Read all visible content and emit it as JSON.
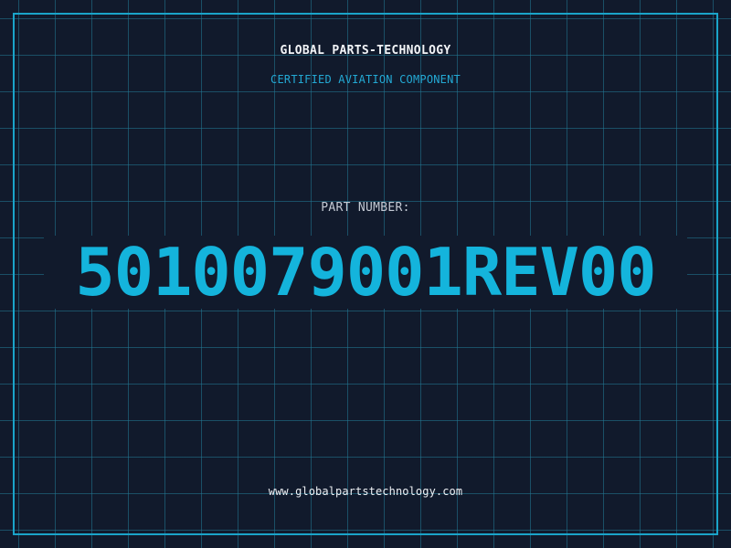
{
  "header": {
    "company": "GLOBAL PARTS-TECHNOLOGY",
    "tagline": "CERTIFIED AVIATION COMPONENT"
  },
  "part": {
    "label": "PART NUMBER:",
    "number": "5010079001REV00"
  },
  "footer": {
    "website": "www.globalpartstechnology.com"
  },
  "colors": {
    "background": "#111a2c",
    "grid": "#227a96",
    "border": "#1aa4c9",
    "accent": "#14b4dc",
    "text": "#f2f4f7"
  }
}
